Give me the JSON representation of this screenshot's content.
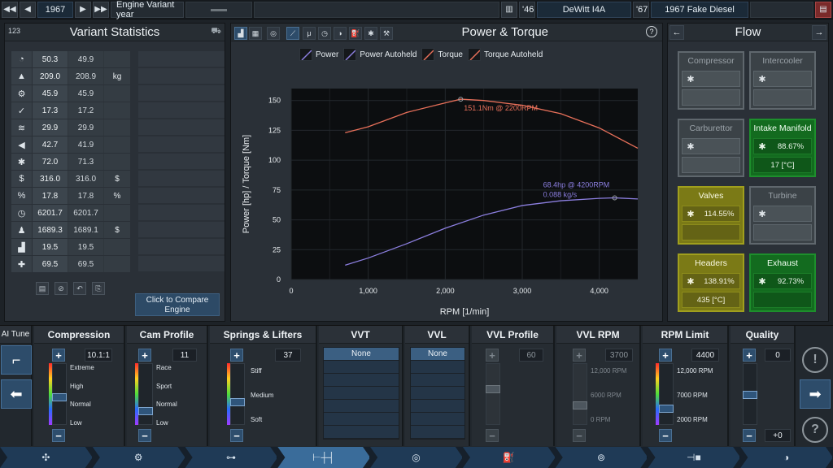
{
  "topbar": {
    "year_value": "1967",
    "year_label": "Engine Variant year",
    "year_left_short": "'46",
    "engine_family": "DeWitt I4A",
    "year_right_short": "'67",
    "variant_name": "1967 Fake Diesel"
  },
  "stats": {
    "badge": "123",
    "title": "Variant Statistics",
    "rows": [
      {
        "icon": "gauge-icon",
        "glyph": "◔",
        "current": "50.3",
        "previous": "49.9",
        "unit": ""
      },
      {
        "icon": "weight-icon",
        "glyph": "▲",
        "current": "209.0",
        "previous": "208.9",
        "unit": "kg"
      },
      {
        "icon": "engine-icon",
        "glyph": "⚙",
        "current": "45.9",
        "previous": "45.9",
        "unit": ""
      },
      {
        "icon": "reliability-icon",
        "glyph": "✓",
        "current": "17.3",
        "previous": "17.2",
        "unit": ""
      },
      {
        "icon": "heat-icon",
        "glyph": "≋",
        "current": "29.9",
        "previous": "29.9",
        "unit": ""
      },
      {
        "icon": "sound-icon",
        "glyph": "◀",
        "current": "42.7",
        "previous": "41.9",
        "unit": ""
      },
      {
        "icon": "cooling-icon",
        "glyph": "✱",
        "current": "72.0",
        "previous": "71.3",
        "unit": ""
      },
      {
        "icon": "cost-icon",
        "glyph": "$",
        "current": "316.0",
        "previous": "316.0",
        "unit": "$"
      },
      {
        "icon": "efficiency-icon",
        "glyph": "%",
        "current": "17.8",
        "previous": "17.8",
        "unit": "%"
      },
      {
        "icon": "engineering-time-icon",
        "glyph": "◷",
        "current": "6201.7",
        "previous": "6201.7",
        "unit": ""
      },
      {
        "icon": "worker-icon",
        "glyph": "♟",
        "current": "1689.3",
        "previous": "1689.1",
        "unit": "$"
      },
      {
        "icon": "fuel-icon",
        "glyph": "▟",
        "current": "19.5",
        "previous": "19.5",
        "unit": ""
      },
      {
        "icon": "service-icon",
        "glyph": "✚",
        "current": "69.5",
        "previous": "69.5",
        "unit": ""
      }
    ],
    "compare_button": "Click to Compare Engine"
  },
  "power_panel": {
    "title": "Power & Torque",
    "legend": [
      {
        "name": "Power",
        "color": "#8c7fe0"
      },
      {
        "name": "Power Autoheld",
        "color": "#8c7fe0"
      },
      {
        "name": "Torque",
        "color": "#e8705a"
      },
      {
        "name": "Torque Autoheld",
        "color": "#e8705a"
      }
    ],
    "torque_annotation": "151.1Nm @ 2200RPM",
    "power_annotation_1": "68.4hp @ 4200RPM",
    "power_annotation_2": "0.088 kg/s"
  },
  "chart_data": {
    "type": "line",
    "xlabel": "RPM [1/min]",
    "ylabel": "Power [hp] / Torque [Nm]",
    "xlim": [
      0,
      4500
    ],
    "ylim": [
      0,
      160
    ],
    "x_ticks": [
      "0",
      "1,000",
      "2,000",
      "3,000",
      "4,000"
    ],
    "y_ticks": [
      "0",
      "25",
      "50",
      "75",
      "100",
      "125",
      "150"
    ],
    "grid": true,
    "series": [
      {
        "name": "Power",
        "color": "#8c7fe0",
        "x": [
          700,
          1000,
          1500,
          2000,
          2500,
          3000,
          3500,
          4000,
          4200,
          4500
        ],
        "y": [
          12,
          18,
          30,
          43,
          54,
          62,
          66,
          68,
          68.4,
          67.5
        ]
      },
      {
        "name": "Torque",
        "color": "#e8705a",
        "x": [
          700,
          1000,
          1500,
          2000,
          2200,
          2500,
          3000,
          3500,
          4000,
          4500
        ],
        "y": [
          123,
          128,
          140,
          148,
          151.1,
          150,
          146,
          139,
          127,
          110
        ]
      }
    ],
    "annotations": [
      {
        "text": "151.1Nm @ 2200RPM",
        "x": 2200,
        "y": 151.1,
        "color": "#e8705a"
      },
      {
        "text": "68.4hp @ 4200RPM",
        "x": 4200,
        "y": 68.4,
        "color": "#8c7fe0"
      }
    ]
  },
  "flow": {
    "title": "Flow",
    "boxes": [
      {
        "name": "Compressor",
        "state": "grey",
        "pct": "",
        "temp": ""
      },
      {
        "name": "Intercooler",
        "state": "grey",
        "pct": "",
        "temp": ""
      },
      {
        "name": "Carburettor",
        "state": "grey",
        "pct": "",
        "temp": ""
      },
      {
        "name": "Intake Manifold",
        "state": "green",
        "pct": "88.67%",
        "temp": "17 [°C]"
      },
      {
        "name": "Valves",
        "state": "yellow",
        "pct": "114.55%",
        "temp": ""
      },
      {
        "name": "Turbine",
        "state": "grey",
        "pct": "",
        "temp": ""
      },
      {
        "name": "Headers",
        "state": "yellow",
        "pct": "138.91%",
        "temp": "435 [°C]"
      },
      {
        "name": "Exhaust",
        "state": "green",
        "pct": "92.73%",
        "temp": ""
      }
    ]
  },
  "controls": {
    "ai_tune": "AI Tune",
    "compression": {
      "title": "Compression",
      "value": "10.1:1",
      "labels": [
        "Extreme",
        "High",
        "Normal",
        "Low"
      ],
      "level": 0.45
    },
    "cam_profile": {
      "title": "Cam Profile",
      "value": "11",
      "labels": [
        "Race",
        "Sport",
        "Normal",
        "Low"
      ],
      "level": 0.2
    },
    "springs": {
      "title": "Springs & Lifters",
      "value": "37",
      "labels": [
        "Stiff",
        "Medium",
        "Soft"
      ],
      "level": 0.37
    },
    "vvt": {
      "title": "VVT",
      "selected": "None"
    },
    "vvl": {
      "title": "VVL",
      "selected": "None"
    },
    "vvl_profile": {
      "title": "VVL Profile",
      "value": "60",
      "level": 0.6
    },
    "vvl_rpm": {
      "title": "VVL RPM",
      "value": "3700",
      "labels": [
        "12,000 RPM",
        "6000 RPM",
        "0 RPM"
      ],
      "level": 0.3
    },
    "rpm_limit": {
      "title": "RPM Limit",
      "value": "4400",
      "labels": [
        "12,000 RPM",
        "7000 RPM",
        "2000 RPM"
      ],
      "level": 0.24
    },
    "quality": {
      "title": "Quality",
      "value": "0",
      "bottom_value": "+0",
      "level": 0.5
    }
  },
  "bottom_tabs": [
    "family",
    "variant-main",
    "bottom-end",
    "top-end",
    "aspiration",
    "fuel",
    "exhaust",
    "tune",
    "test"
  ]
}
